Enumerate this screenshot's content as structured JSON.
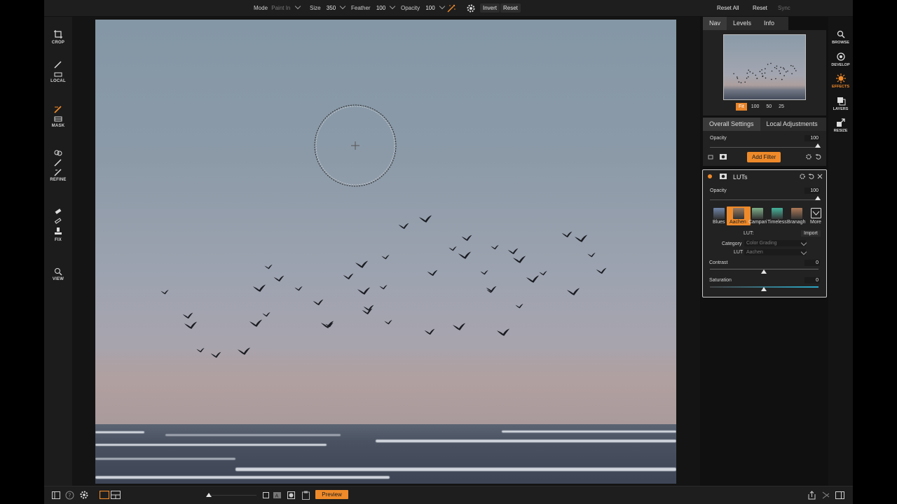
{
  "toolbar": {
    "mode_label": "Mode",
    "mode_value": "Paint In",
    "size_label": "Size",
    "size_value": "350",
    "feather_label": "Feather",
    "feather_value": "100",
    "opacity_label": "Opacity",
    "opacity_value": "100",
    "invert_label": "Invert",
    "reset_label": "Reset"
  },
  "left_tools": [
    {
      "label": "CROP",
      "icon": "crop-icon"
    },
    {
      "label": "LOCAL",
      "icon": "local-brush-icon"
    },
    {
      "label": "MASK",
      "icon": "mask-brush-icon"
    },
    {
      "label": "REFINE",
      "icon": "refine-icon"
    },
    {
      "label": "FIX",
      "icon": "stamp-icon"
    },
    {
      "label": "VIEW",
      "icon": "magnifier-icon"
    }
  ],
  "nav_tabs": [
    "Nav",
    "Levels",
    "Info"
  ],
  "zoom_options": [
    "Fit",
    "100",
    "50",
    "25"
  ],
  "settings_tabs": [
    "Overall Settings",
    "Local Adjustments"
  ],
  "overall": {
    "opacity_label": "Opacity",
    "opacity_value": "100",
    "add_filter_label": "Add Filter"
  },
  "lut_panel": {
    "title": "LUTs",
    "opacity_label": "Opacity",
    "opacity_value": "100",
    "presets": [
      {
        "label": "Blues",
        "color": "#6f86a8"
      },
      {
        "label": "Aachen",
        "color": "#9a7a60"
      },
      {
        "label": "Campari",
        "color": "#7fb08a"
      },
      {
        "label": "Timeless",
        "color": "#46b49c"
      },
      {
        "label": "Branagh",
        "color": "#b07a58"
      }
    ],
    "more_label": "More",
    "lut_label": "LUT:",
    "import_label": "Import",
    "category_label": "Category",
    "category_value": "Color Grading",
    "lut_select_label": "LUT",
    "lut_select_value": "Aachen",
    "contrast_label": "Contrast",
    "contrast_value": "0",
    "saturation_label": "Saturation",
    "saturation_value": "0"
  },
  "right_modules": [
    {
      "label": "BROWSE",
      "icon": "browse-icon"
    },
    {
      "label": "DEVELOP",
      "icon": "develop-icon"
    },
    {
      "label": "EFFECTS",
      "icon": "effects-icon"
    },
    {
      "label": "LAYERS",
      "icon": "layers-icon"
    },
    {
      "label": "RESIZE",
      "icon": "resize-icon"
    }
  ],
  "bottom": {
    "preview_label": "Preview",
    "reset_all_label": "Reset All",
    "reset_label": "Reset",
    "sync_label": "Sync"
  },
  "colors": {
    "accent": "#ef8a2a",
    "panel": "#222222",
    "background": "#000000"
  }
}
